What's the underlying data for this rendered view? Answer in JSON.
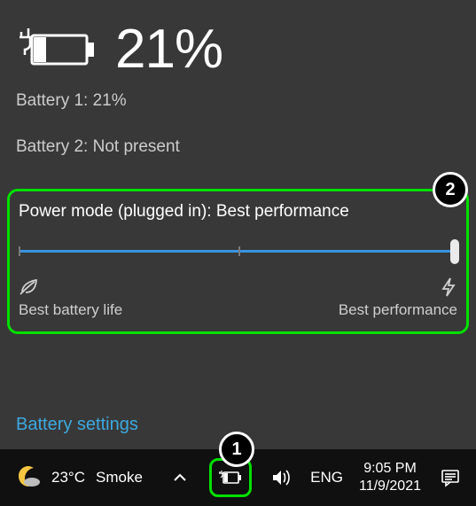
{
  "header": {
    "percentage": "21%"
  },
  "batteries": [
    {
      "label": "Battery 1: 21%"
    },
    {
      "label": "Battery 2: Not present"
    }
  ],
  "power": {
    "mode_label": "Power mode (plugged in): Best performance",
    "left_label": "Best battery life",
    "right_label": "Best performance",
    "slider_value": 100
  },
  "link": {
    "settings": "Battery settings"
  },
  "taskbar": {
    "weather_temp": "23°C",
    "weather_cond": "Smoke",
    "lang": "ENG",
    "time": "9:05 PM",
    "date": "11/9/2021"
  },
  "annotations": {
    "a1": "1",
    "a2": "2"
  },
  "colors": {
    "accent": "#3da9e0",
    "highlight": "#00e000"
  }
}
